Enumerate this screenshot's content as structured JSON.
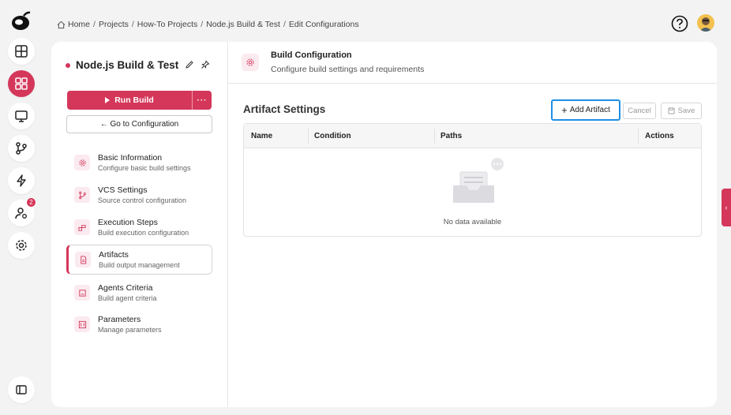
{
  "breadcrumb": [
    "Home",
    "Projects",
    "How-To Projects",
    "Node.js Build & Test",
    "Edit Configurations"
  ],
  "rail": {
    "items": [
      "dashboard-icon",
      "apps-icon",
      "monitor-icon",
      "git-branch-icon",
      "lightning-icon",
      "user-settings-icon",
      "gear-icon"
    ],
    "notification_count": "2",
    "bottom": "sidebar-toggle-icon"
  },
  "project": {
    "title": "Node.js Build & Test",
    "run_label": "Run Build",
    "more_label": "···",
    "goto_label": "← Go to Configuration"
  },
  "nav": [
    {
      "title": "Basic Information",
      "subtitle": "Configure basic build settings"
    },
    {
      "title": "VCS Settings",
      "subtitle": "Source control configuration"
    },
    {
      "title": "Execution Steps",
      "subtitle": "Build execution configuration"
    },
    {
      "title": "Artifacts",
      "subtitle": "Build output management"
    },
    {
      "title": "Agents Criteria",
      "subtitle": "Build agent criteria"
    },
    {
      "title": "Parameters",
      "subtitle": "Manage parameters"
    }
  ],
  "header": {
    "title": "Build Configuration",
    "subtitle": "Configure build settings and requirements"
  },
  "section": {
    "title": "Artifact Settings",
    "add_label": "Add Artifact",
    "cancel_label": "Cancel",
    "save_label": "Save"
  },
  "table": {
    "columns": [
      "Name",
      "Condition",
      "Paths",
      "Actions"
    ],
    "empty_text": "No data available"
  },
  "colors": {
    "accent": "#d4375a",
    "focus": "#1e90e6"
  }
}
